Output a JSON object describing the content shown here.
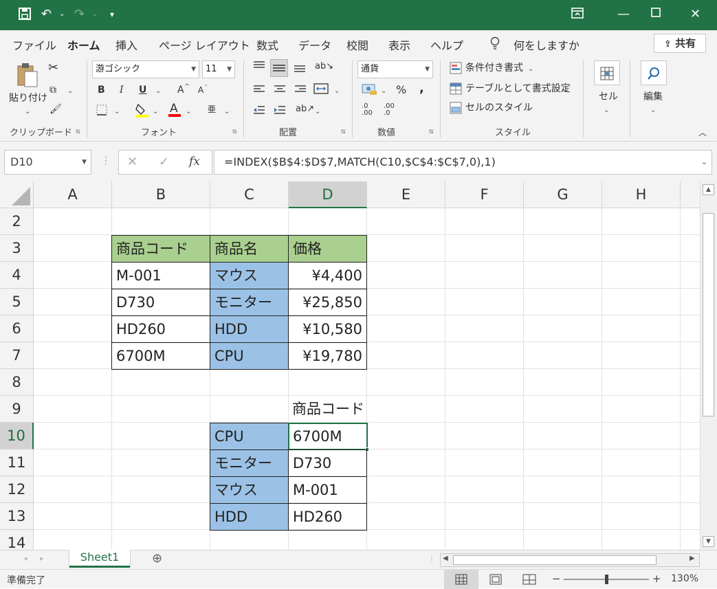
{
  "titlebar": {
    "qat_save": "save-icon",
    "qat_undo": "undo-icon",
    "qat_redo": "redo-icon",
    "qat_customize": "customize-icon"
  },
  "tabs": {
    "file": "ファイル",
    "home": "ホーム",
    "insert": "挿入",
    "page_layout": "ページ レイアウト",
    "formulas": "数式",
    "data": "データ",
    "review": "校閲",
    "view": "表示",
    "help": "ヘルプ",
    "tell_me": "何をしますか",
    "share": "共有"
  },
  "ribbon": {
    "clipboard": {
      "paste": "貼り付け",
      "label": "クリップボード"
    },
    "font": {
      "name": "游ゴシック",
      "size": "11",
      "bold": "B",
      "italic": "I",
      "underline": "U",
      "grow": "A",
      "shrink": "A",
      "label": "フォント"
    },
    "alignment": {
      "label": "配置"
    },
    "number": {
      "format": "通貨",
      "percent": "%",
      "comma": ",",
      "label": "数値"
    },
    "styles": {
      "conditional": "条件付き書式",
      "table": "テーブルとして書式設定",
      "cell_styles": "セルのスタイル",
      "label": "スタイル"
    },
    "cells": {
      "label": "セル"
    },
    "editing": {
      "label": "編集"
    }
  },
  "formula_bar": {
    "name_box": "D10",
    "cancel": "✕",
    "enter": "✓",
    "fx": "fx",
    "formula": "=INDEX($B$4:$D$7,MATCH(C10,$C$4:$C$7,0),1)"
  },
  "columns": [
    "A",
    "B",
    "C",
    "D",
    "E",
    "F",
    "G",
    "H"
  ],
  "rows": [
    "2",
    "3",
    "4",
    "5",
    "6",
    "7",
    "8",
    "9",
    "10",
    "11",
    "12",
    "13",
    "14"
  ],
  "table1": {
    "headers": [
      "商品コード",
      "商品名",
      "価格"
    ],
    "rows": [
      [
        "M-001",
        "マウス",
        "¥4,400"
      ],
      [
        "D730",
        "モニター",
        "¥25,850"
      ],
      [
        "HD260",
        "HDD",
        "¥10,580"
      ],
      [
        "6700M",
        "CPU",
        "¥19,780"
      ]
    ]
  },
  "table2": {
    "header": "商品コード",
    "rows": [
      [
        "CPU",
        "6700M"
      ],
      [
        "モニター",
        "D730"
      ],
      [
        "マウス",
        "M-001"
      ],
      [
        "HDD",
        "HD260"
      ]
    ]
  },
  "sheet_tabs": {
    "active": "Sheet1",
    "add": "⊕"
  },
  "status": {
    "ready": "準備完了",
    "zoom": "130%",
    "minus": "−",
    "plus": "+"
  }
}
